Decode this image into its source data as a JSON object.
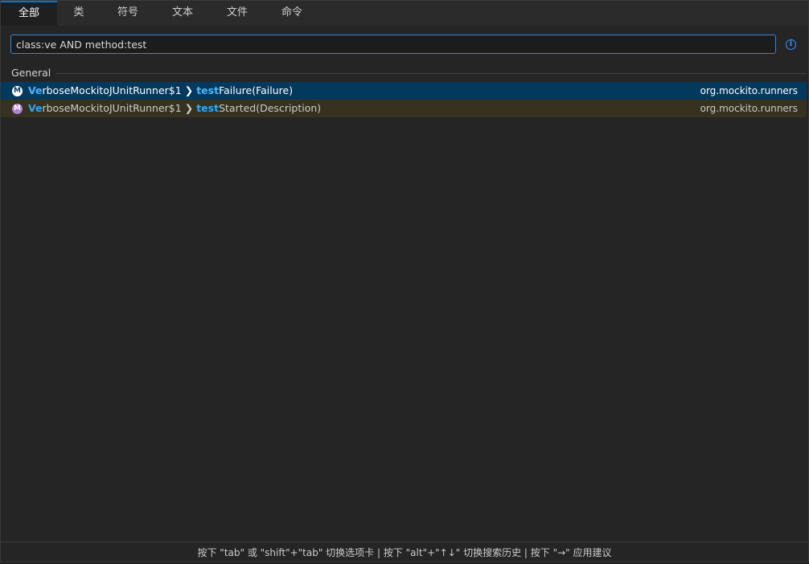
{
  "tabs": [
    {
      "label": "全部",
      "active": true
    },
    {
      "label": "类"
    },
    {
      "label": "符号"
    },
    {
      "label": "文本"
    },
    {
      "label": "文件"
    },
    {
      "label": "命令"
    }
  ],
  "search": {
    "value": "class:ve AND method:test",
    "info_icon": "info-icon"
  },
  "group": {
    "title": "General"
  },
  "results": [
    {
      "icon_letter": "M",
      "class_match": "Ve",
      "class_rest": "rboseMockitoJUnitRunner$1",
      "separator": "❯",
      "method_match": "test",
      "method_rest": "Failure(Failure)",
      "package": "org.mockito.runners"
    },
    {
      "icon_letter": "M",
      "class_match": "Ve",
      "class_rest": "rboseMockitoJUnitRunner$1",
      "separator": "❯",
      "method_match": "test",
      "method_rest": "Started(Description)",
      "package": "org.mockito.runners"
    }
  ],
  "footer": {
    "hint": "按下 \"tab\" 或 \"shift\"+\"tab\" 切换选项卡 | 按下 \"alt\"+\"↑↓\" 切换搜索历史 | 按下 \"→\" 应用建议"
  },
  "colors": {
    "accent": "#0078d4",
    "selection": "#04395e",
    "hover": "#37311f",
    "match": "#2aaaff",
    "method_icon": "#b180d7"
  }
}
